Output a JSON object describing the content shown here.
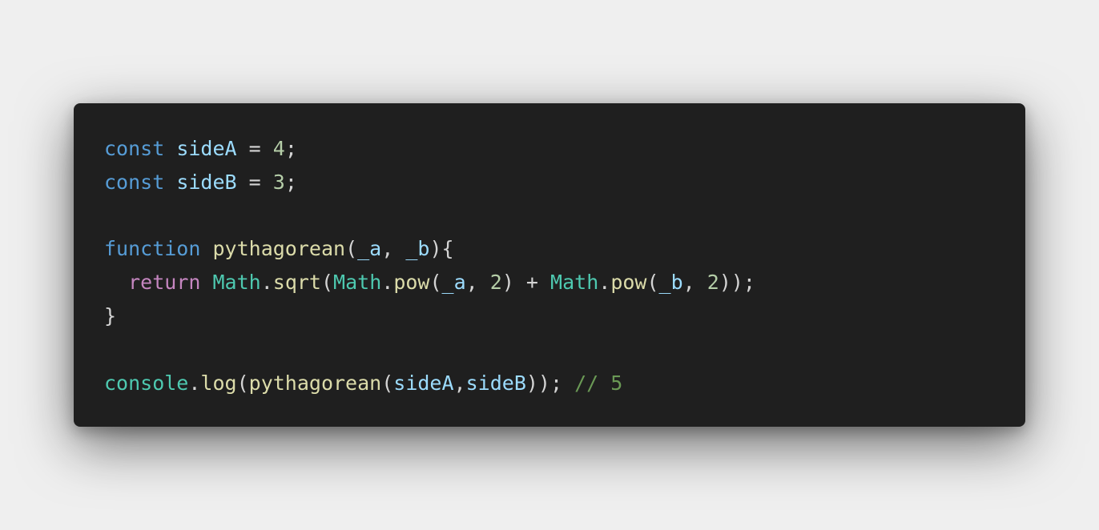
{
  "colors": {
    "background": "#efefef",
    "editor_background": "#1f1f1f",
    "keyword": "#569cd6",
    "control_keyword": "#c586c0",
    "variable": "#9cdcfe",
    "number": "#b5cea8",
    "function": "#dcdcaa",
    "class": "#4ec9b0",
    "comment": "#6a9955",
    "punctuation": "#d4d4d4"
  },
  "code": {
    "lines": [
      [
        {
          "text": "const",
          "type": "keyword"
        },
        {
          "text": " ",
          "type": "punct"
        },
        {
          "text": "sideA",
          "type": "variable"
        },
        {
          "text": " = ",
          "type": "punct"
        },
        {
          "text": "4",
          "type": "number"
        },
        {
          "text": ";",
          "type": "punct"
        }
      ],
      [
        {
          "text": "const",
          "type": "keyword"
        },
        {
          "text": " ",
          "type": "punct"
        },
        {
          "text": "sideB",
          "type": "variable"
        },
        {
          "text": " = ",
          "type": "punct"
        },
        {
          "text": "3",
          "type": "number"
        },
        {
          "text": ";",
          "type": "punct"
        }
      ],
      [],
      [
        {
          "text": "function",
          "type": "keyword"
        },
        {
          "text": " ",
          "type": "punct"
        },
        {
          "text": "pythagorean",
          "type": "function"
        },
        {
          "text": "(",
          "type": "punct"
        },
        {
          "text": "_a",
          "type": "variable"
        },
        {
          "text": ", ",
          "type": "punct"
        },
        {
          "text": "_b",
          "type": "variable"
        },
        {
          "text": "){",
          "type": "punct"
        }
      ],
      [
        {
          "text": "  ",
          "type": "punct"
        },
        {
          "text": "return",
          "type": "control"
        },
        {
          "text": " ",
          "type": "punct"
        },
        {
          "text": "Math",
          "type": "class"
        },
        {
          "text": ".",
          "type": "punct"
        },
        {
          "text": "sqrt",
          "type": "function"
        },
        {
          "text": "(",
          "type": "punct"
        },
        {
          "text": "Math",
          "type": "class"
        },
        {
          "text": ".",
          "type": "punct"
        },
        {
          "text": "pow",
          "type": "function"
        },
        {
          "text": "(",
          "type": "punct"
        },
        {
          "text": "_a",
          "type": "variable"
        },
        {
          "text": ", ",
          "type": "punct"
        },
        {
          "text": "2",
          "type": "number"
        },
        {
          "text": ") + ",
          "type": "punct"
        },
        {
          "text": "Math",
          "type": "class"
        },
        {
          "text": ".",
          "type": "punct"
        },
        {
          "text": "pow",
          "type": "function"
        },
        {
          "text": "(",
          "type": "punct"
        },
        {
          "text": "_b",
          "type": "variable"
        },
        {
          "text": ", ",
          "type": "punct"
        },
        {
          "text": "2",
          "type": "number"
        },
        {
          "text": "));",
          "type": "punct"
        }
      ],
      [
        {
          "text": "}",
          "type": "punct"
        }
      ],
      [],
      [
        {
          "text": "console",
          "type": "class"
        },
        {
          "text": ".",
          "type": "punct"
        },
        {
          "text": "log",
          "type": "function"
        },
        {
          "text": "(",
          "type": "punct"
        },
        {
          "text": "pythagorean",
          "type": "function"
        },
        {
          "text": "(",
          "type": "punct"
        },
        {
          "text": "sideA",
          "type": "variable"
        },
        {
          "text": ",",
          "type": "punct"
        },
        {
          "text": "sideB",
          "type": "variable"
        },
        {
          "text": ")); ",
          "type": "punct"
        },
        {
          "text": "// 5",
          "type": "comment"
        }
      ]
    ]
  }
}
